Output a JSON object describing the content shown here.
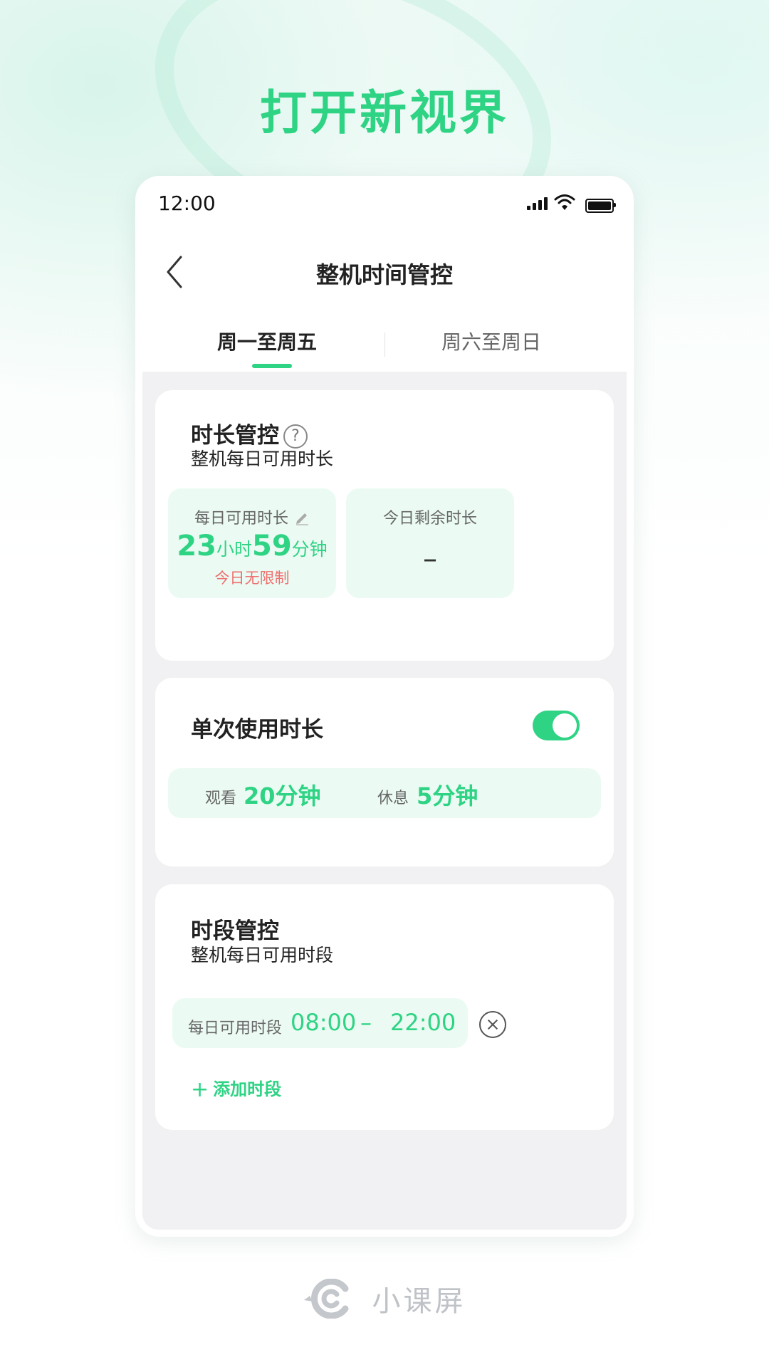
{
  "headline": "打开新视界",
  "status_bar": {
    "time": "12:00"
  },
  "nav": {
    "title": "整机时间管控"
  },
  "tabs": [
    {
      "label": "周一至周五",
      "selected": true
    },
    {
      "label": "周六至周日",
      "selected": false
    }
  ],
  "duration_card": {
    "title": "时长管控",
    "help_glyph": "?",
    "subtitle": "整机每日可用时长",
    "daily_tile": {
      "label": "每日可用时长",
      "hours": "23",
      "hours_unit": "小时",
      "minutes": "59",
      "minutes_unit": "分钟",
      "note": "今日无限制"
    },
    "remaining_tile": {
      "label": "今日剩余时长",
      "value": "–"
    }
  },
  "session_card": {
    "title": "单次使用时长",
    "toggle_on": true,
    "watch_label": "观看",
    "watch_value": "20分钟",
    "rest_label": "休息",
    "rest_value": "5分钟"
  },
  "period_card": {
    "title": "时段管控",
    "subtitle": "整机每日可用时段",
    "period_label": "每日可用时段",
    "start": "08:00",
    "separator": "–",
    "end": "22:00",
    "add_label": "添加时段"
  },
  "brand": {
    "name": "小课屏"
  },
  "colors": {
    "accent": "#2ed384",
    "warning": "#ef6f6f",
    "tile_bg": "#ebfbf3",
    "page_bg": "#f1f1f3"
  }
}
